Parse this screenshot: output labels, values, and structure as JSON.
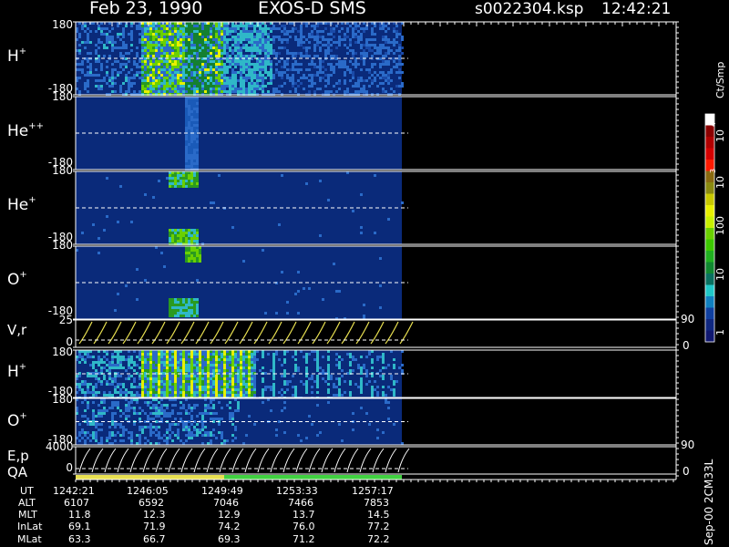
{
  "header": {
    "date": "Feb 23, 1990",
    "mission": "EXOS-D SMS",
    "file": "s0022304.ksp",
    "time": "12:42:21"
  },
  "colorbar": {
    "unit": "Ct/Smp",
    "labels": [
      "10",
      "4",
      "10",
      "3",
      "100",
      "10",
      "1"
    ],
    "colors": [
      "#ffffff",
      "#8b0000",
      "#b00000",
      "#d40000",
      "#ff1a00",
      "#8a6a10",
      "#8a8a10",
      "#c8c800",
      "#e8f000",
      "#c8f000",
      "#6ad000",
      "#3cc800",
      "#20b020",
      "#108830",
      "#0a7060",
      "#20c8c8",
      "#1080c0",
      "#1040a0",
      "#102880",
      "#101870"
    ]
  },
  "panels": [
    {
      "label_base": "H",
      "label_sup": "+",
      "top_tick": "180",
      "bot_tick": "-180"
    },
    {
      "label_base": "He",
      "label_sup": "++",
      "top_tick": "180",
      "bot_tick": "-180"
    },
    {
      "label_base": "He",
      "label_sup": "+",
      "top_tick": "180",
      "bot_tick": "-180"
    },
    {
      "label_base": "O",
      "label_sup": "+",
      "top_tick": "180",
      "bot_tick": "-180"
    },
    {
      "label_base": "V,r",
      "label_sup": "",
      "top_tick": "25",
      "bot_tick": "0",
      "right_top": "90",
      "right_bot": "0"
    },
    {
      "label_base": "H",
      "label_sup": "+",
      "top_tick": "180",
      "bot_tick": "-180"
    },
    {
      "label_base": "O",
      "label_sup": "+",
      "top_tick": "180",
      "bot_tick": "-180"
    },
    {
      "label_base": "E,p",
      "label_sup": "",
      "top_tick": "4000",
      "bot_tick": "0",
      "right_top": "90",
      "right_bot": "0"
    }
  ],
  "qa_label": "QA",
  "footer_right": "Sep-00 2CM33L",
  "orbit_table": {
    "row_labels": [
      "UT",
      "ALT",
      "MLT",
      "InLat",
      "MLat"
    ],
    "columns": [
      [
        "1242:21",
        "6107",
        "11.8",
        "69.1",
        "63.3"
      ],
      [
        "1246:05",
        "6592",
        "12.3",
        "71.9",
        "66.7"
      ],
      [
        "1249:49",
        "7046",
        "12.9",
        "74.2",
        "69.3"
      ],
      [
        "1253:33",
        "7466",
        "13.7",
        "76.0",
        "71.2"
      ],
      [
        "1257:17",
        "7853",
        "14.5",
        "77.2",
        "72.2"
      ]
    ]
  },
  "chart_data": {
    "type": "heatmap",
    "title": "Feb 23, 1990 EXOS-D SMS",
    "x_ticks_ut": [
      "1242:21",
      "1246:05",
      "1249:49",
      "1253:33",
      "1257:17"
    ],
    "colorbar_scale": "log",
    "colorbar_range": [
      1,
      10000
    ],
    "colorbar_unit": "Ct/Smp",
    "panels": [
      "H+",
      "He++",
      "He+",
      "O+",
      "V,r",
      "H+",
      "O+",
      "E,p"
    ],
    "pitch_angle_range": [
      -180,
      180
    ],
    "vr_range": [
      0,
      25
    ],
    "ep_range": [
      0,
      4000
    ]
  }
}
